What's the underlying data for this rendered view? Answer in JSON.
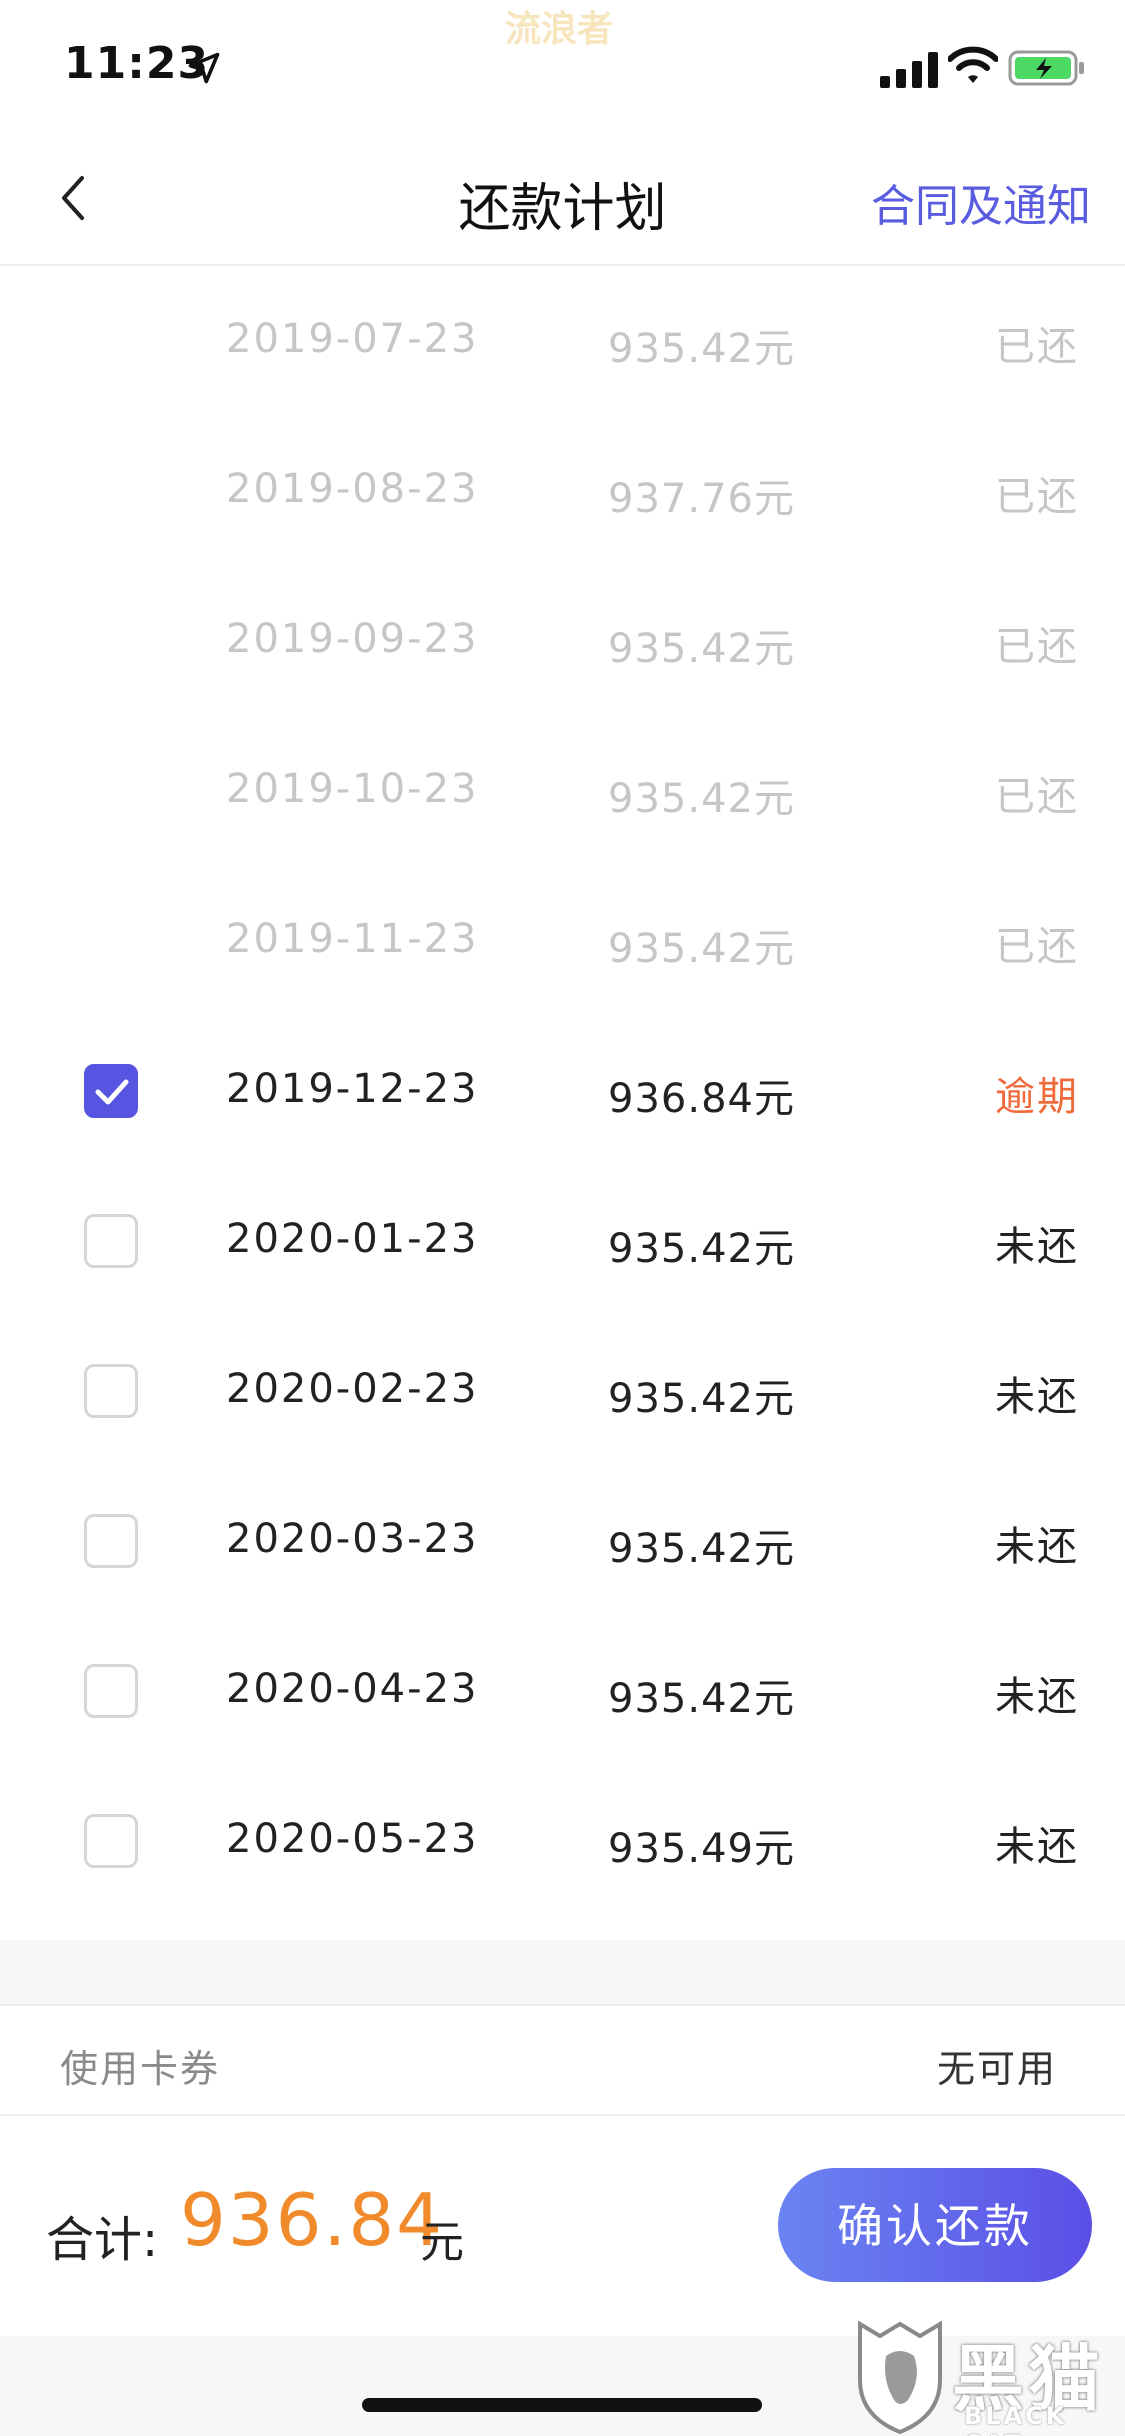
{
  "status_bar": {
    "time": "11:23",
    "watermark": "流浪者"
  },
  "nav": {
    "title": "还款计划",
    "right_link": "合同及通知"
  },
  "plan": {
    "rows": [
      {
        "date": "2019-07-23",
        "amount": "935.42元",
        "status": "已还",
        "state": "paid",
        "checked": false
      },
      {
        "date": "2019-08-23",
        "amount": "937.76元",
        "status": "已还",
        "state": "paid",
        "checked": false
      },
      {
        "date": "2019-09-23",
        "amount": "935.42元",
        "status": "已还",
        "state": "paid",
        "checked": false
      },
      {
        "date": "2019-10-23",
        "amount": "935.42元",
        "status": "已还",
        "state": "paid",
        "checked": false
      },
      {
        "date": "2019-11-23",
        "amount": "935.42元",
        "status": "已还",
        "state": "paid",
        "checked": false
      },
      {
        "date": "2019-12-23",
        "amount": "936.84元",
        "status": "逾期",
        "state": "overdue",
        "checked": true
      },
      {
        "date": "2020-01-23",
        "amount": "935.42元",
        "status": "未还",
        "state": "unpaid",
        "checked": false
      },
      {
        "date": "2020-02-23",
        "amount": "935.42元",
        "status": "未还",
        "state": "unpaid",
        "checked": false
      },
      {
        "date": "2020-03-23",
        "amount": "935.42元",
        "status": "未还",
        "state": "unpaid",
        "checked": false
      },
      {
        "date": "2020-04-23",
        "amount": "935.42元",
        "status": "未还",
        "state": "unpaid",
        "checked": false
      },
      {
        "date": "2020-05-23",
        "amount": "935.49元",
        "status": "未还",
        "state": "unpaid",
        "checked": false
      }
    ]
  },
  "coupon": {
    "label": "使用卡券",
    "value": "无可用"
  },
  "summary": {
    "total_label": "合计:",
    "total_amount": "936.84",
    "total_unit": "元",
    "confirm_label": "确认还款"
  },
  "corner_watermark": {
    "text_cn": "黑猫",
    "text_en": "BLACK CAT"
  },
  "colors": {
    "accent": "#5654e0",
    "overdue": "#f06a3c",
    "total": "#f08a2a",
    "paid_text": "#c6c6c6"
  }
}
